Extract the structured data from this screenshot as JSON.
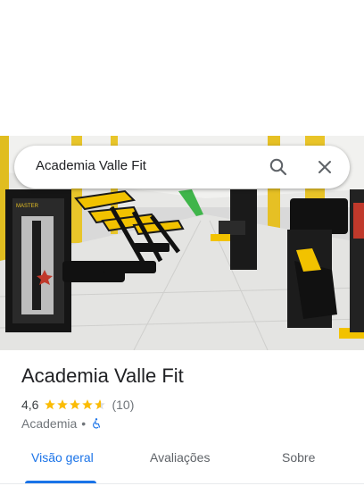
{
  "search": {
    "query": "Academia Valle Fit"
  },
  "place": {
    "name": "Academia Valle Fit",
    "rating": "4,6",
    "rating_stars": 4.6,
    "review_count": "(10)",
    "category": "Academia",
    "separator": "•",
    "accessibility_icon": "wheelchair-icon"
  },
  "tabs": [
    {
      "label": "Visão geral",
      "active": true
    },
    {
      "label": "Avaliações",
      "active": false
    },
    {
      "label": "Sobre",
      "active": false
    }
  ],
  "colors": {
    "accent": "#1a73e8",
    "star": "#fbbc04",
    "brand_equipment": "#f4c20d"
  },
  "photo": {
    "equipment_label": "MASTER"
  }
}
